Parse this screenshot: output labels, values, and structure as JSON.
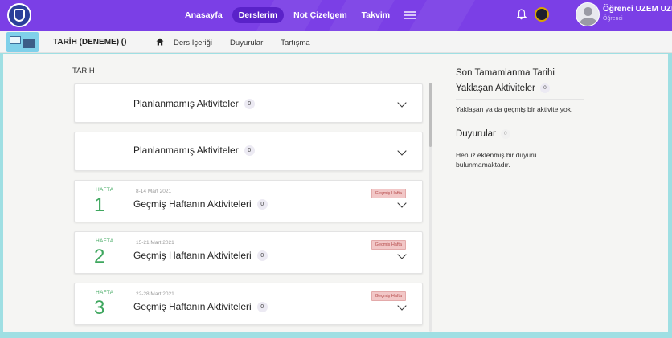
{
  "topbar": {
    "nav": [
      {
        "label": "Anasayfa",
        "active": false
      },
      {
        "label": "Derslerim",
        "active": true
      },
      {
        "label": "Not Çizelgem",
        "active": false
      },
      {
        "label": "Takvim",
        "active": false
      }
    ],
    "user": {
      "name": "Öğrenci UZEM UZEM",
      "role": "Öğrenci"
    },
    "colors": {
      "bar": "#7b3fe6",
      "active_pill": "#5a22c9"
    }
  },
  "course": {
    "title": "TARİH (DENEME) ()",
    "tabs": [
      "Ders İçeriği",
      "Duyurular",
      "Tartışma"
    ]
  },
  "main": {
    "section_label": "TARİH",
    "unplanned": [
      {
        "title": "Planlanmamış Aktiviteler",
        "count": "0"
      },
      {
        "title": "Planlanmamış Aktiviteler",
        "count": "0"
      }
    ],
    "weeks": [
      {
        "label": "HAFTA",
        "number": "1",
        "date": "8-14 Mart 2021",
        "title": "Geçmiş Haftanın Aktiviteleri",
        "count": "0",
        "badge": "Geçmiş Hafta"
      },
      {
        "label": "HAFTA",
        "number": "2",
        "date": "15-21 Mart 2021",
        "title": "Geçmiş Haftanın Aktiviteleri",
        "count": "0",
        "badge": "Geçmiş Hafta"
      },
      {
        "label": "HAFTA",
        "number": "3",
        "date": "22-28 Mart 2021",
        "title": "Geçmiş Haftanın Aktiviteleri",
        "count": "0",
        "badge": "Geçmiş Hafta"
      }
    ],
    "colors": {
      "week_accent": "#3fa75f",
      "past_badge_bg": "#f2c7c7"
    }
  },
  "sidebar": {
    "deadline_title": "Son Tamamlanma Tarihi",
    "upcoming_title": "Yaklaşan Aktiviteler",
    "upcoming_count": "0",
    "upcoming_empty": "Yaklaşan ya da geçmiş bir aktivite yok.",
    "announcements_title": "Duyurular",
    "announcements_count": "0",
    "announcements_empty": "Henüz eklenmiş bir duyuru bulunmamaktadır."
  }
}
